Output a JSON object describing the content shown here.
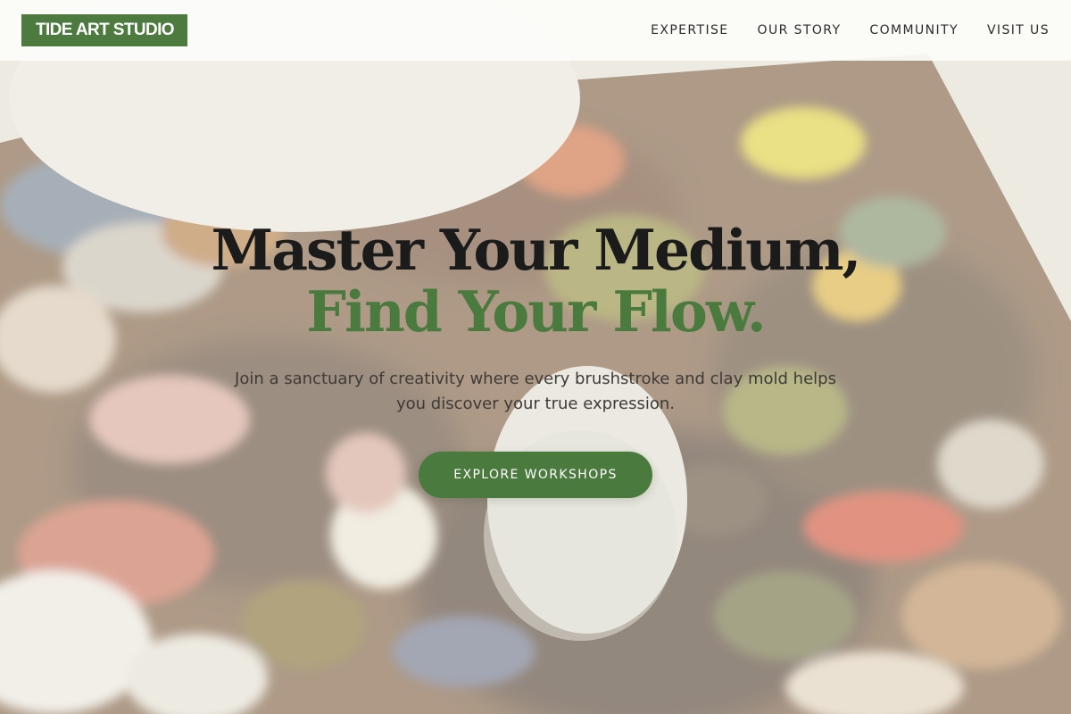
{
  "header": {
    "logo_text": "TIDE ART STUDIO",
    "nav": [
      {
        "label": "EXPERTISE"
      },
      {
        "label": "OUR STORY"
      },
      {
        "label": "COMMUNITY"
      },
      {
        "label": "VISIT US"
      }
    ]
  },
  "hero": {
    "headline_line1": "Master Your Medium,",
    "headline_line2": "Find Your Flow.",
    "subtitle": "Join a sanctuary of creativity where every brushstroke and clay mold helps you discover your true expression.",
    "cta_label": "EXPLORE WORKSHOPS"
  },
  "colors": {
    "brand_green": "#4b7a3e",
    "headline_dark": "#1b1b1b",
    "header_bg": "#fcfcfa"
  }
}
